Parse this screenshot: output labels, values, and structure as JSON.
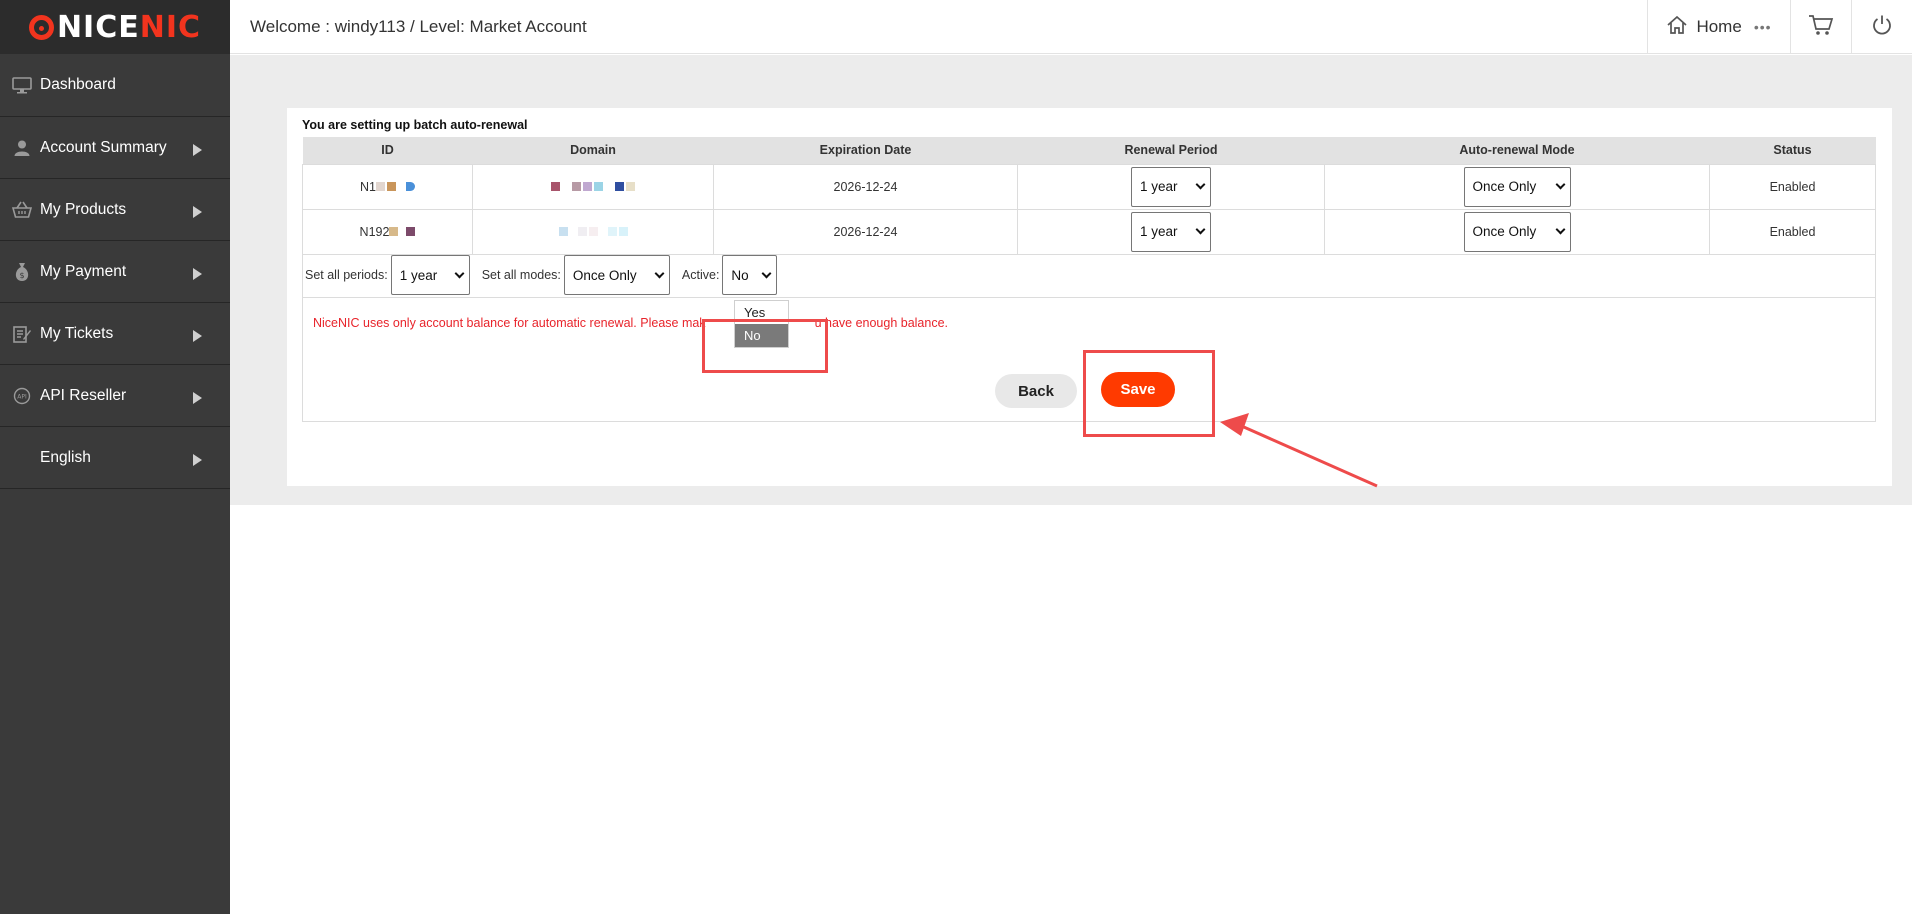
{
  "brand": {
    "logo_prefix": "NICE",
    "logo_suffix": "NIC"
  },
  "sidebar": {
    "items": [
      {
        "label": "Dashboard",
        "icon": "monitor-icon",
        "has_arrow": false
      },
      {
        "label": "Account Summary",
        "icon": "user-icon",
        "has_arrow": true
      },
      {
        "label": "My Products",
        "icon": "basket-icon",
        "has_arrow": true
      },
      {
        "label": "My Payment",
        "icon": "money-bag-icon",
        "has_arrow": true
      },
      {
        "label": "My Tickets",
        "icon": "ticket-edit-icon",
        "has_arrow": true
      },
      {
        "label": "API Reseller",
        "icon": "api-icon",
        "has_arrow": true
      },
      {
        "label": "English",
        "icon": "",
        "has_arrow": true
      }
    ]
  },
  "header": {
    "welcome": "Welcome : windy113  /  Level: Market Account",
    "home_label": "Home",
    "more_label": "•••"
  },
  "card": {
    "title": "You are setting up batch auto-renewal",
    "columns": [
      "ID",
      "Domain",
      "Expiration Date",
      "Renewal Period",
      "Auto-renewal Mode",
      "Status"
    ],
    "rows": [
      {
        "id": "N1",
        "expiration": "2026-12-24",
        "period": "1 year",
        "mode": "Once Only",
        "status": "Enabled"
      },
      {
        "id": "N192",
        "expiration": "2026-12-24",
        "period": "1 year",
        "mode": "Once Only",
        "status": "Enabled"
      }
    ],
    "bulk": {
      "periods_label": "Set all periods:",
      "periods_value": "1 year",
      "modes_label": "Set all modes:",
      "modes_value": "Once Only",
      "active_label": "Active:",
      "active_value": "No"
    },
    "active_dropdown": {
      "options": [
        "Yes",
        "No"
      ],
      "highlighted": "No"
    },
    "notice_before": "NiceNIC uses only account balance for automatic renewal. Please mak",
    "notice_after": "u have enough balance.",
    "back_label": "Back",
    "save_label": "Save"
  },
  "colors": {
    "brand_red": "#f2341e",
    "save_button": "#ff3a00",
    "annotation_red": "#ee4b4b",
    "enabled_green": "#2e8b2e",
    "notice_red": "#e8242b",
    "sidebar_bg": "#3a3a3a"
  }
}
